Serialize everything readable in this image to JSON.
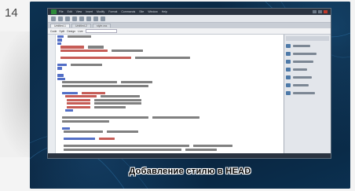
{
  "slide": {
    "number": "14",
    "caption": "Добавление стилю в HEAD"
  },
  "editor_window": {
    "menu": [
      "File",
      "Edit",
      "View",
      "Insert",
      "Modify",
      "Format",
      "Commands",
      "Site",
      "Window",
      "Help"
    ],
    "tabs": [
      "Untitled-1",
      "Untitled-2",
      "style.css"
    ],
    "doc_toolbar": [
      "Code",
      "Split",
      "Design",
      "Live"
    ],
    "accent": "#2e8b3a"
  },
  "colors": {
    "slide_bg": "#0a2a44",
    "code_tag": "#1a3fb3",
    "code_attr": "#b3261e",
    "code_text": "#555555"
  }
}
